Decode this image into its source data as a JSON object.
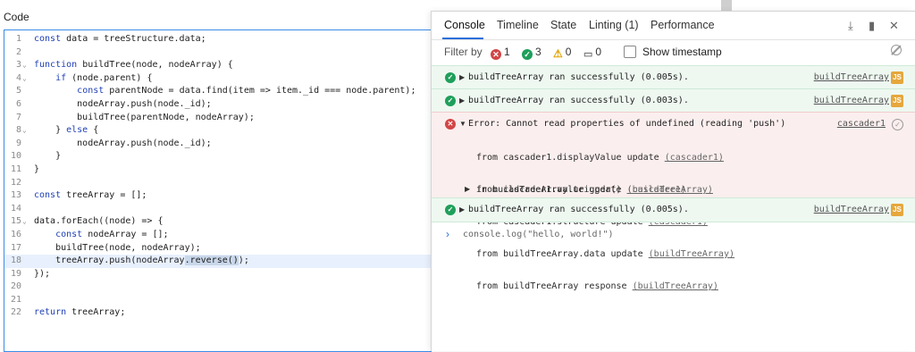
{
  "editor": {
    "heading": "Code",
    "lines": [
      {
        "n": "1",
        "fold": "",
        "code": "const data = treeStructure.data;"
      },
      {
        "n": "2",
        "fold": "",
        "code": ""
      },
      {
        "n": "3",
        "fold": "⌄",
        "code": "function buildTree(node, nodeArray) {"
      },
      {
        "n": "4",
        "fold": "⌄",
        "code": "    if (node.parent) {"
      },
      {
        "n": "5",
        "fold": "",
        "code": "        const parentNode = data.find(item => item._id === node.parent);"
      },
      {
        "n": "6",
        "fold": "",
        "code": "        nodeArray.push(node._id);"
      },
      {
        "n": "7",
        "fold": "",
        "code": "        buildTree(parentNode, nodeArray);"
      },
      {
        "n": "8",
        "fold": "⌄",
        "code": "    } else {"
      },
      {
        "n": "9",
        "fold": "",
        "code": "        nodeArray.push(node._id);"
      },
      {
        "n": "10",
        "fold": "",
        "code": "    }"
      },
      {
        "n": "11",
        "fold": "",
        "code": "}"
      },
      {
        "n": "12",
        "fold": "",
        "code": ""
      },
      {
        "n": "13",
        "fold": "",
        "code": "const treeArray = [];"
      },
      {
        "n": "14",
        "fold": "",
        "code": ""
      },
      {
        "n": "15",
        "fold": "⌄",
        "code": "data.forEach((node) => {"
      },
      {
        "n": "16",
        "fold": "",
        "code": "    const nodeArray = [];"
      },
      {
        "n": "17",
        "fold": "",
        "code": "    buildTree(node, nodeArray);"
      },
      {
        "n": "18",
        "fold": "",
        "code": "    treeArray.push(nodeArray.reverse());",
        "active": true
      },
      {
        "n": "19",
        "fold": "",
        "code": "});"
      },
      {
        "n": "20",
        "fold": "",
        "code": ""
      },
      {
        "n": "21",
        "fold": "",
        "code": ""
      },
      {
        "n": "22",
        "fold": "",
        "code": "return treeArray;"
      }
    ]
  },
  "console": {
    "tabs": [
      {
        "label": "Console",
        "active": true
      },
      {
        "label": "Timeline"
      },
      {
        "label": "State"
      },
      {
        "label": "Linting (1)"
      },
      {
        "label": "Performance"
      }
    ],
    "filter": {
      "label": "Filter by",
      "errors": "1",
      "success": "3",
      "warnings": "0",
      "messages": "0",
      "timestamp_label": "Show timestamp"
    },
    "entries": [
      {
        "kind": "success",
        "message": "buildTreeArray ran successfully (0.005s).",
        "source": "buildTreeArray",
        "badge": "JS"
      },
      {
        "kind": "success",
        "message": "buildTreeArray ran successfully (0.003s).",
        "source": "buildTreeArray",
        "badge": "JS"
      },
      {
        "kind": "error",
        "message": "Error: Cannot read properties of undefined (reading 'push')",
        "source": "cascader1",
        "stack": [
          {
            "text": "from cascader1.displayValue update ",
            "link": "(cascader1)"
          },
          {
            "text": "from cascader1.value update ",
            "link": "(cascader1)"
          },
          {
            "text": "from cascader1.structure update ",
            "link": "(cascader1)"
          },
          {
            "text": "from buildTreeArray.data update ",
            "link": "(buildTreeArray)"
          },
          {
            "text": "from buildTreeArray response ",
            "link": "(buildTreeArray)"
          },
          {
            "text": "in buildTreeArray.trigger() ",
            "link": "(buildTreeArray)"
          }
        ]
      },
      {
        "kind": "success",
        "message": "buildTreeArray ran successfully (0.005s).",
        "source": "buildTreeArray",
        "badge": "JS"
      }
    ],
    "repl": {
      "prompt": "›",
      "input": "console.log(\"hello, world!\")"
    }
  },
  "colors": {
    "accent": "#2a6fdb",
    "success": "#1e9f5a",
    "error": "#d24545",
    "js_badge": "#e6a73c"
  }
}
